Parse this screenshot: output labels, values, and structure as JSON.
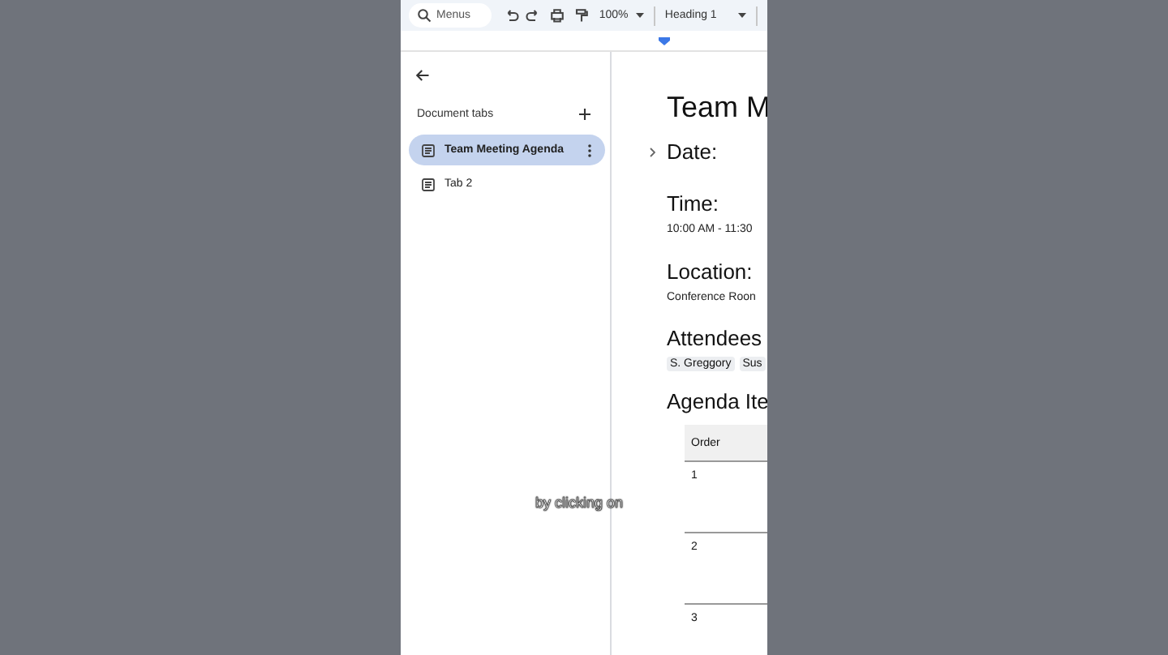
{
  "toolbar": {
    "search": {
      "placeholder": "Menus"
    },
    "zoom": "100%",
    "style": "Heading 1"
  },
  "sidebar": {
    "title": "Document tabs",
    "tabs": [
      {
        "label": "Team Meeting Agenda",
        "selected": true
      },
      {
        "label": "Tab 2",
        "selected": false
      }
    ]
  },
  "document": {
    "title": "Team M",
    "sections": [
      {
        "heading": "Date:",
        "collapsible": true
      },
      {
        "heading": "Time:",
        "text": "10:00 AM - 11:30"
      },
      {
        "heading": "Location:",
        "text": "Conference Roon"
      },
      {
        "heading": "Attendees",
        "chips": [
          "S. Greggory",
          "Sus"
        ]
      },
      {
        "heading": "Agenda Ite"
      }
    ],
    "table": {
      "columns": [
        "Order"
      ],
      "rows": [
        [
          "1"
        ],
        [
          "2"
        ],
        [
          "3"
        ]
      ]
    }
  },
  "caption": "by clicking on"
}
